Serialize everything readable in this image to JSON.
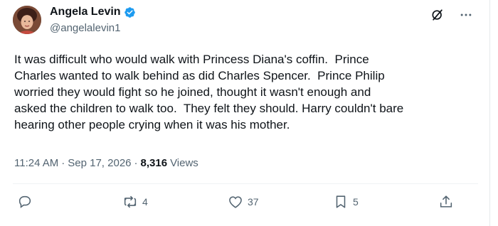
{
  "author": {
    "name": "Angela Levin",
    "handle": "@angelalevin1",
    "verified": true
  },
  "tweet": {
    "text": "It was difficult who would walk with Princess Diana's coffin.  Prince\nCharles wanted to walk behind as did Charles Spencer.  Prince Philip\nworried they would fight so he joined, thought it wasn't enough and\nasked the children to walk too.  They felt they should. Harry couldn't bare\nhearing other people crying when it was his mother.",
    "time": "11:24 AM",
    "separator": "·",
    "date": "Sep 17, 2026",
    "views_count": "8,316",
    "views_label": "Views"
  },
  "actions": {
    "replies": "",
    "reposts": "4",
    "likes": "37",
    "bookmarks": "5"
  },
  "colors": {
    "verified": "#1d9bf0",
    "icon": "#536471",
    "text": "#0f1419"
  },
  "icons": [
    "grok-icon",
    "more-icon",
    "reply-icon",
    "repost-icon",
    "like-icon",
    "bookmark-icon",
    "share-icon"
  ]
}
